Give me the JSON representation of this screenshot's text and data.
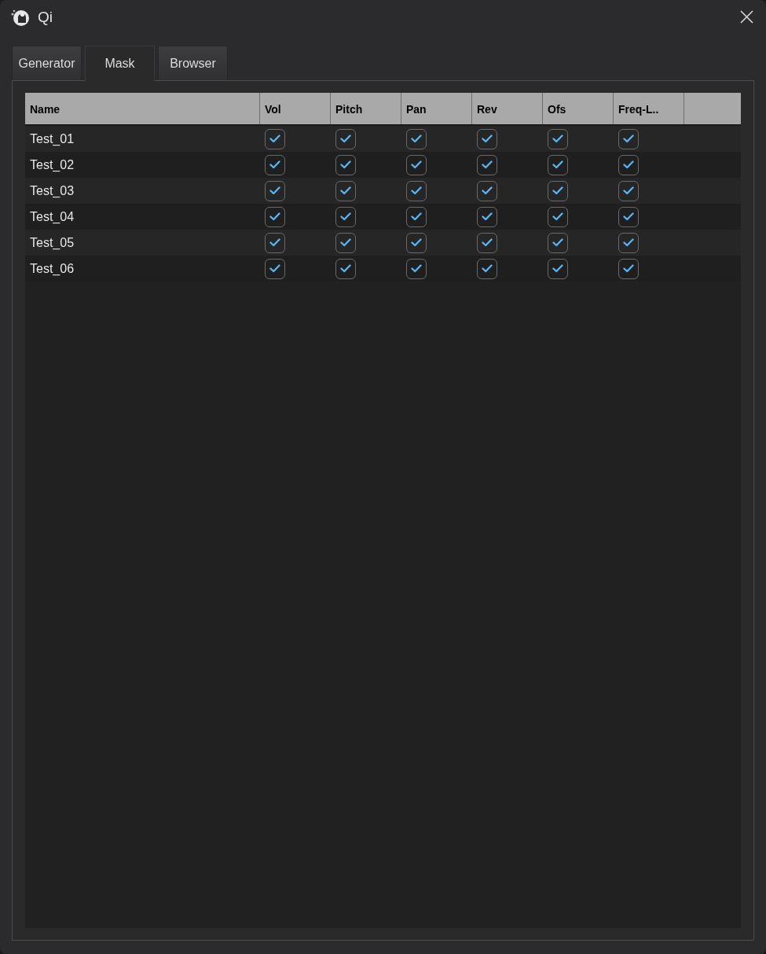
{
  "window": {
    "title": "Qi"
  },
  "tabs": [
    {
      "label": "Generator",
      "selected": false
    },
    {
      "label": "Mask",
      "selected": true
    },
    {
      "label": "Browser",
      "selected": false
    }
  ],
  "table": {
    "columns": [
      "Name",
      "Vol",
      "Pitch",
      "Pan",
      "Rev",
      "Ofs",
      "Freq-L.."
    ],
    "rows": [
      {
        "name": "Test_01",
        "checks": [
          true,
          true,
          true,
          true,
          true,
          true
        ]
      },
      {
        "name": "Test_02",
        "checks": [
          true,
          true,
          true,
          true,
          true,
          true
        ]
      },
      {
        "name": "Test_03",
        "checks": [
          true,
          true,
          true,
          true,
          true,
          true
        ]
      },
      {
        "name": "Test_04",
        "checks": [
          true,
          true,
          true,
          true,
          true,
          true
        ]
      },
      {
        "name": "Test_05",
        "checks": [
          true,
          true,
          true,
          true,
          true,
          true
        ]
      },
      {
        "name": "Test_06",
        "checks": [
          true,
          true,
          true,
          true,
          true,
          true
        ]
      }
    ]
  }
}
